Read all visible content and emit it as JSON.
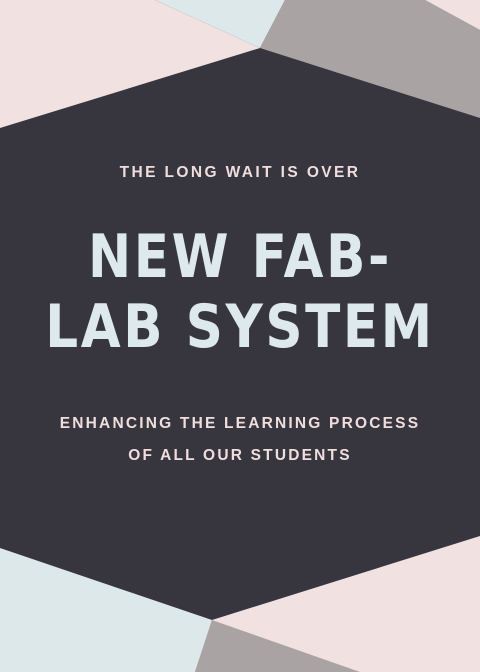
{
  "poster": {
    "kicker": "THE LONG WAIT IS OVER",
    "headline_line1": "NEW FAB-",
    "headline_line2": "LAB SYSTEM",
    "subline_line1": "ENHANCING THE LEARNING PROCESS",
    "subline_line2": "OF ALL OUR STUDENTS"
  },
  "colors": {
    "background": "#37363f",
    "blush": "#f1e1e1",
    "ice": "#dde8ea",
    "taupe": "#aaa3a4",
    "headline": "#dde9ec",
    "body_text": "#f0dede"
  }
}
